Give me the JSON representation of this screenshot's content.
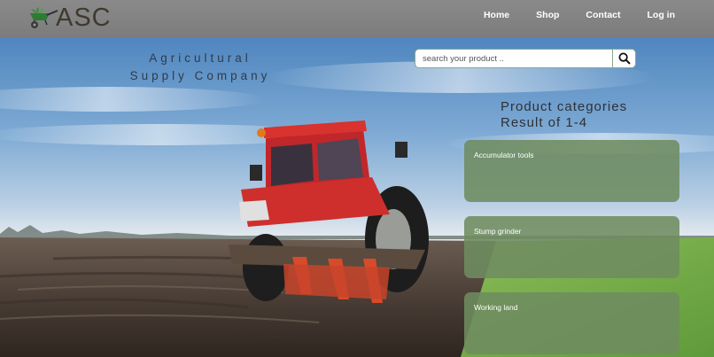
{
  "header": {
    "logo_text": "ASC",
    "nav": {
      "home": "Home",
      "shop": "Shop",
      "contact": "Contact",
      "login": "Log in"
    }
  },
  "hero": {
    "company_line1": "Agricultural",
    "company_line2": "Supply Company",
    "search": {
      "placeholder": "search your product .."
    },
    "categories_title": "Product categories",
    "categories_result": "Result of 1-4",
    "categories": [
      {
        "label": "Accumulator tools"
      },
      {
        "label": "Stump grinder"
      },
      {
        "label": "Working land"
      }
    ]
  },
  "colors": {
    "header_bg": "#808080",
    "card_bg": "#6e8c60",
    "search_border": "#8aa889",
    "logo": "#3f3a2e"
  }
}
